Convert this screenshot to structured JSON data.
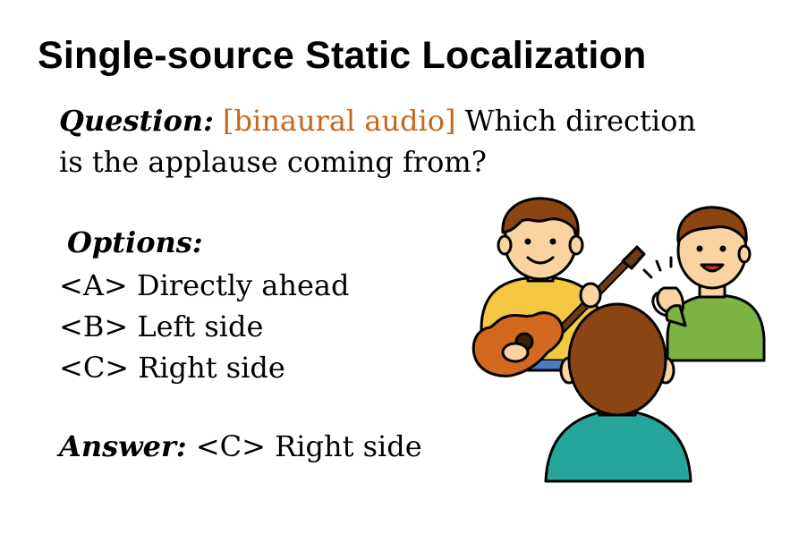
{
  "slide": {
    "title": "Single-source Static Localization",
    "question": {
      "label": "Question:",
      "tag": "[binaural audio]",
      "text": "Which direction is the applause coming from?"
    },
    "options": {
      "title": "Options:",
      "items": [
        "<A> Directly ahead",
        "<B> Left side",
        "<C> Right side"
      ]
    },
    "answer": {
      "label": "Answer:",
      "value": "<C> Right side"
    }
  },
  "colors": {
    "tag": "#c8651b",
    "guitarist_shirt": "#f5c842",
    "clapper_shirt": "#7cb342",
    "listener_shirt": "#26a69a",
    "hair": "#8b4513"
  },
  "illustration": {
    "icons": [
      "guitarist-figure",
      "clapping-figure",
      "listener-figure"
    ]
  }
}
